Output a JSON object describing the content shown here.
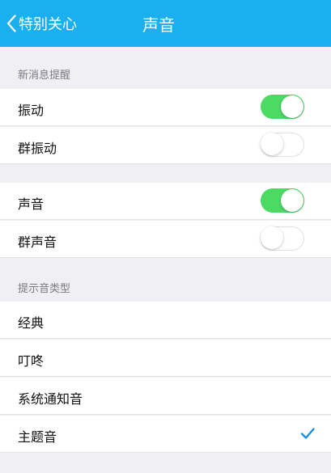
{
  "nav": {
    "back_label": "特别关心",
    "title": "声音"
  },
  "sections": {
    "new_message": {
      "header": "新消息提醒"
    },
    "sound_type": {
      "header": "提示音类型"
    }
  },
  "rows": {
    "vibrate": {
      "label": "振动",
      "enabled": true
    },
    "group_vibrate": {
      "label": "群振动",
      "enabled": false
    },
    "sound": {
      "label": "声音",
      "enabled": true
    },
    "group_sound": {
      "label": "群声音",
      "enabled": false
    }
  },
  "sound_types": {
    "classic": {
      "label": "经典",
      "selected": false
    },
    "dingdong": {
      "label": "叮咚",
      "selected": false
    },
    "system": {
      "label": "系统通知音",
      "selected": false
    },
    "theme": {
      "label": "主题音",
      "selected": true
    }
  },
  "colors": {
    "nav_bar": "#1ab0f0",
    "toggle_on": "#4cd964",
    "checkmark": "#1a8fe0"
  },
  "icons": {
    "back": "chevron-left-icon",
    "selected": "checkmark-icon"
  }
}
